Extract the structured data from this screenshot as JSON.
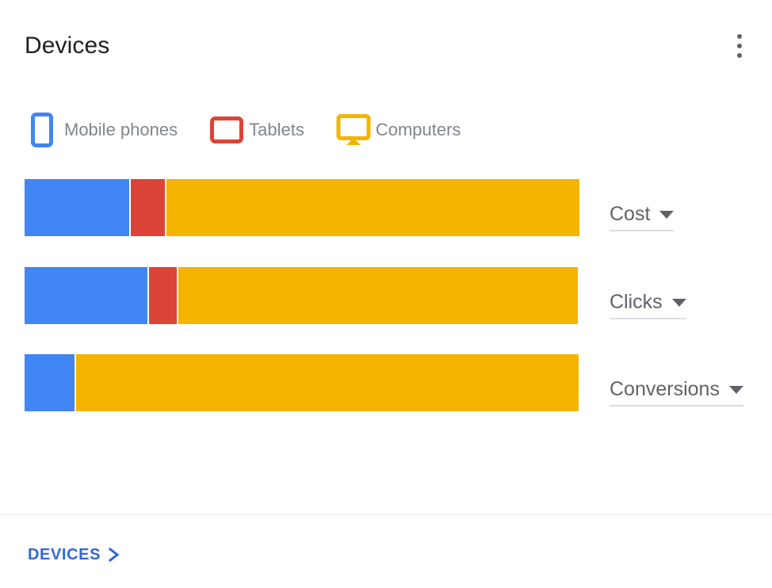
{
  "header": {
    "title": "Devices",
    "menu_icon": "kebab-menu-icon"
  },
  "legend": {
    "items": [
      {
        "label": "Mobile phones",
        "icon": "mobile-phone-icon",
        "color": "#4285F4"
      },
      {
        "label": "Tablets",
        "icon": "tablet-icon",
        "color": "#DB4437"
      },
      {
        "label": "Computers",
        "icon": "computer-monitor-icon",
        "color": "#F4B400"
      }
    ]
  },
  "chart_data": {
    "type": "bar",
    "title": "Devices",
    "orientation": "horizontal",
    "stacked": true,
    "normalized": true,
    "grid": false,
    "legend_position": "top",
    "xlabel": "",
    "ylabel": "",
    "xlim": [
      0,
      100
    ],
    "categories": [
      "Cost",
      "Clicks",
      "Conversions"
    ],
    "series": [
      {
        "name": "Mobile phones",
        "color": "#4285F4",
        "values": [
          18.9,
          22.1,
          9.0
        ]
      },
      {
        "name": "Tablets",
        "color": "#DB4437",
        "values": [
          6.1,
          5.0,
          0.0
        ]
      },
      {
        "name": "Computers",
        "color": "#F4B400",
        "values": [
          74.4,
          72.1,
          90.6
        ]
      }
    ]
  },
  "metric_selectors": [
    {
      "label": "Cost",
      "caret": "chevron-down-icon"
    },
    {
      "label": "Clicks",
      "caret": "chevron-down-icon"
    },
    {
      "label": "Conversions",
      "caret": "chevron-down-icon"
    }
  ],
  "footer": {
    "link_label": "DEVICES",
    "link_icon": "chevron-right-icon",
    "link_color": "#3367d6"
  }
}
